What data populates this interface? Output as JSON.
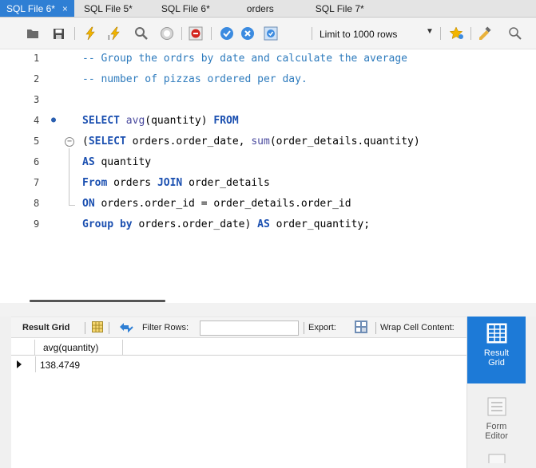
{
  "tabs": [
    {
      "label": "SQL File 6*",
      "active": true,
      "close": "×"
    },
    {
      "label": "SQL File 5*",
      "active": false
    },
    {
      "label": "SQL File 6*",
      "active": false
    },
    {
      "label": "orders",
      "active": false
    },
    {
      "label": "SQL File 7*",
      "active": false
    }
  ],
  "toolbar": {
    "limit_label": "Limit to 1000 rows",
    "icons": [
      "open-folder-icon",
      "save-icon",
      "execute-icon",
      "execute-current-icon",
      "find-icon",
      "stop-icon",
      "toggle-error-icon",
      "commit-icon",
      "rollback-icon",
      "autocommit-icon",
      "favorite-icon",
      "beautify-icon",
      "search-icon"
    ]
  },
  "editor": {
    "lines": [
      {
        "num": "1",
        "text": "-- Group the ordrs by date and calculate the average"
      },
      {
        "num": "2",
        "text": "-- number of pizzas ordered per day."
      },
      {
        "num": "3",
        "text": ""
      },
      {
        "num": "4",
        "text": "SELECT avg(quantity) FROM"
      },
      {
        "num": "5",
        "text": "(SELECT orders.order_date, sum(order_details.quantity)"
      },
      {
        "num": "6",
        "text": "AS quantity"
      },
      {
        "num": "7",
        "text": "From orders JOIN order_details"
      },
      {
        "num": "8",
        "text": "ON orders.order_id = order_details.order_id"
      },
      {
        "num": "9",
        "text": "Group by orders.order_date) AS order_quantity;"
      }
    ]
  },
  "result_toolbar": {
    "result_grid_label": "Result Grid",
    "filter_label": "Filter Rows:",
    "filter_value": "",
    "export_label": "Export:",
    "wrap_label": "Wrap Cell Content:"
  },
  "grid": {
    "columns": [
      "avg(quantity)"
    ],
    "rows": [
      [
        "138.4749"
      ]
    ]
  },
  "side_panel": {
    "result_grid": "Result Grid",
    "form_editor": "Form Editor"
  },
  "colors": {
    "active_tab": "#2f7fd4",
    "comment": "#2e7bbd",
    "keyword": "#1a4fb0",
    "side_active": "#1d7ad7"
  }
}
